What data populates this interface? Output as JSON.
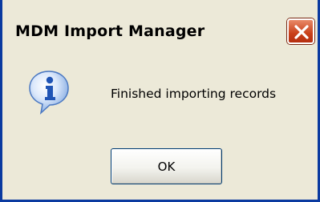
{
  "window": {
    "title": "MDM Import Manager"
  },
  "dialog": {
    "message": "Finished importing records",
    "icon": "info-icon",
    "ok_label": "OK"
  },
  "colors": {
    "frame_blue": "#0a3aa0",
    "dialog_background": "#ece9d8",
    "close_button_red": "#c9401a"
  }
}
